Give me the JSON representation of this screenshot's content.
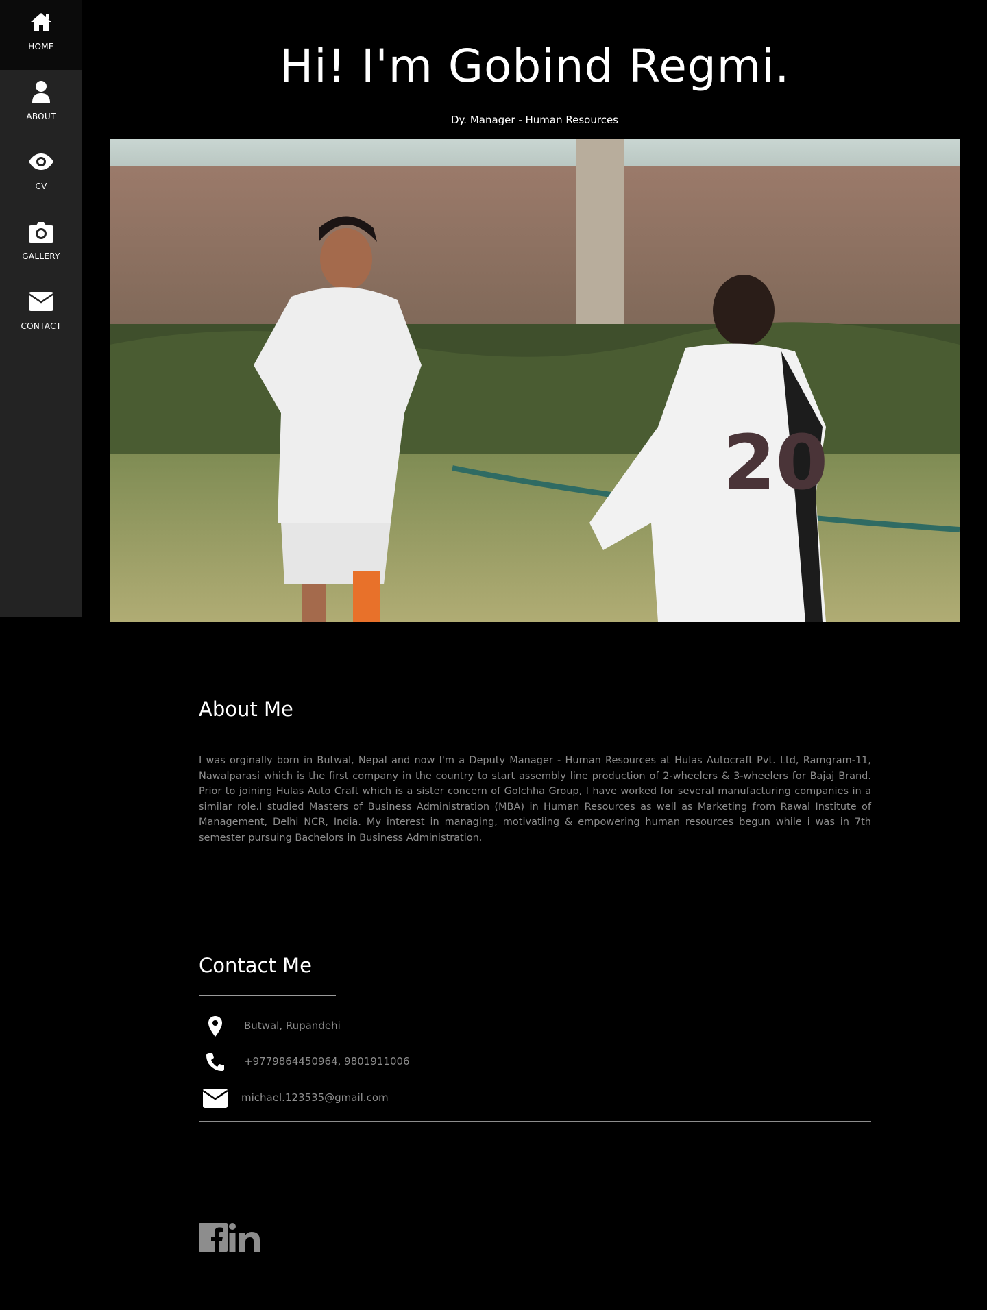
{
  "sidebar": {
    "items": [
      {
        "label": "HOME",
        "icon": "home-icon"
      },
      {
        "label": "ABOUT",
        "icon": "user-icon"
      },
      {
        "label": "CV",
        "icon": "eye-icon"
      },
      {
        "label": "GALLERY",
        "icon": "camera-icon"
      },
      {
        "label": "CONTACT",
        "icon": "envelope-icon"
      }
    ]
  },
  "hero": {
    "title": "Hi! I'm Gobind Regmi.",
    "subtitle": "Dy. Manager - Human Resources"
  },
  "about": {
    "heading": "About Me",
    "text": "I was orginally born in Butwal, Nepal and now I'm a Deputy Manager - Human Resources at Hulas Autocraft Pvt. Ltd, Ramgram-11, Nawalparasi which is the first company in the country to start assembly line production of 2-wheelers & 3-wheelers for Bajaj Brand. Prior to joining Hulas Auto Craft which is a sister concern of Golchha Group, I have worked for several manufacturing companies in a similar role.I studied Masters of Business Administration (MBA) in Human Resources as well as Marketing from Rawal Institute of Management, Delhi NCR, India. My interest in managing, motivatiing & empowering human resources begun while i was in 7th semester pursuing Bachelors in Business Administration."
  },
  "contact": {
    "heading": "Contact Me",
    "location": "Butwal, Rupandehi",
    "phone": "+9779864450964, 9801911006",
    "email": "michael.123535@gmail.com"
  },
  "social": {
    "icons": [
      "facebook-icon",
      "linkedin-icon"
    ],
    "color": "#8d8d8d"
  },
  "colors": {
    "background": "#000000",
    "sidebar": "#232323",
    "sidebar_active": "#0b0b0b",
    "muted_text": "#8d8d8d"
  }
}
